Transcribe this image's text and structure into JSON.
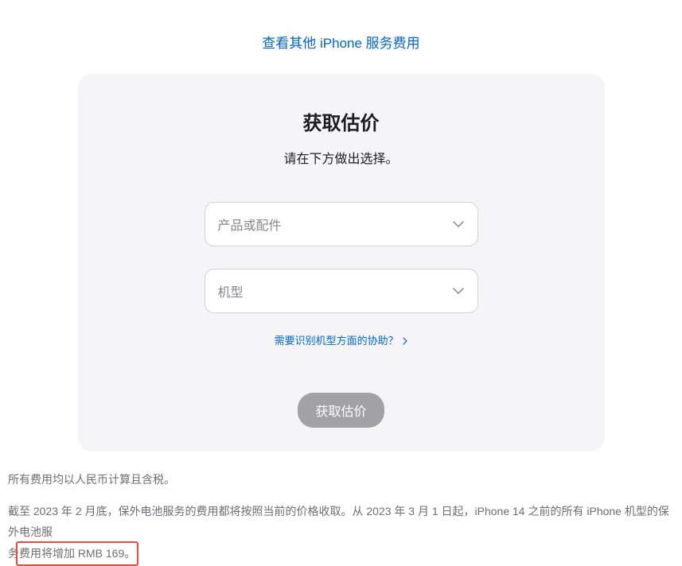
{
  "topLink": "查看其他 iPhone 服务费用",
  "card": {
    "title": "获取估价",
    "subtitle": "请在下方做出选择。",
    "select1": {
      "placeholder": "产品或配件"
    },
    "select2": {
      "placeholder": "机型"
    },
    "helpLink": "需要识别机型方面的协助？",
    "submitLabel": "获取估价"
  },
  "footer": {
    "line1": "所有费用均以人民币计算且含税。",
    "line2_part1": "截至 2023 年 2 月底，保外电池服务的费用都将按照当前的价格收取。从 2023 年 3 月 1 日起，iPhone 14 之前的所有 iPhone 机型的保外电池服",
    "line2_part2": "务",
    "line2_highlight": "费用将增加 RMB 169。"
  }
}
